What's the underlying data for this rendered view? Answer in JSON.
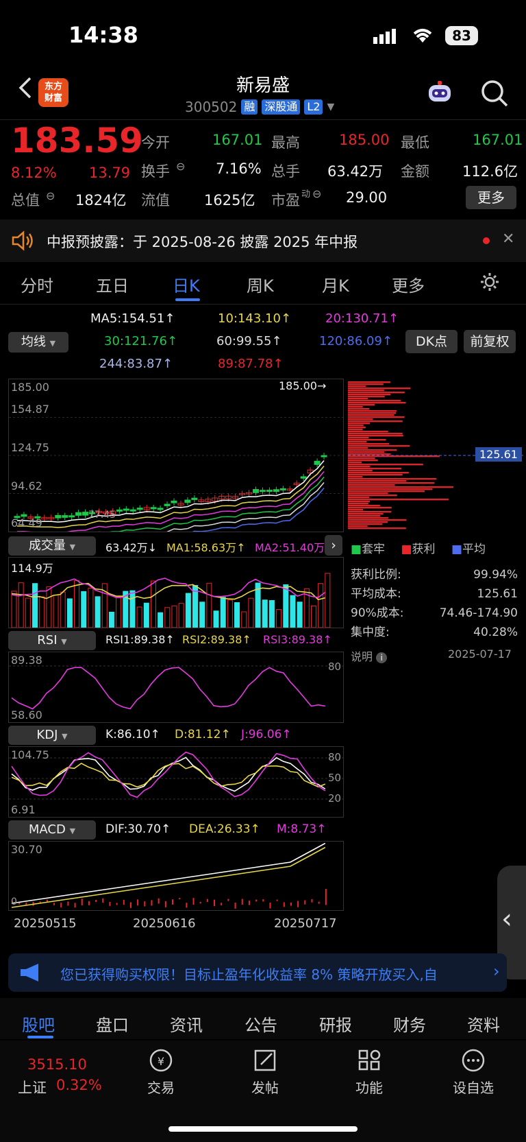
{
  "status": {
    "time": "14:38",
    "battery": "83"
  },
  "header": {
    "back_icon": "chevron-left-icon",
    "logo_text_1": "东方",
    "logo_text_2": "财富",
    "stock_name": "新易盛",
    "stock_code": "300502",
    "tags": [
      "融",
      "深股通",
      "L2"
    ]
  },
  "quote": {
    "price": "183.59",
    "change_pct": "8.12%",
    "change_amt": "13.79",
    "total_value_label": "总值",
    "total_value": "1824亿",
    "open_label": "今开",
    "open": "167.01",
    "turnover_label": "换手",
    "turnover": "7.16%",
    "float_value_label": "流值",
    "float_value": "1625亿",
    "high_label": "最高",
    "high": "185.00",
    "volume_label": "总手",
    "volume": "63.42万",
    "pe_label": "市盈",
    "pe_sup": "动",
    "pe": "29.00",
    "low_label": "最低",
    "low": "167.01",
    "amount_label": "金额",
    "amount": "112.6亿",
    "more_button": "更多"
  },
  "notice": {
    "text": "中报预披露：于 2025-08-26 披露 2025 年中报"
  },
  "chart_tabs": [
    "分时",
    "五日",
    "日K",
    "周K",
    "月K",
    "更多"
  ],
  "active_tab": "日K",
  "ma_panel": {
    "selector": "均线",
    "ma5": "MA5:154.51↑",
    "ma10": "10:143.10↑",
    "ma20": "20:130.71↑",
    "ma30": "30:121.76↑",
    "ma60": "60:99.55↑",
    "ma120": "120:86.09↑",
    "ma244": "244:83.87↑",
    "ma89": "89:87.78↑",
    "dk_button": "DK点",
    "fq_button": "前复权"
  },
  "price_axis": {
    "top": "185.00",
    "l2": "154.87",
    "l3": "124.75",
    "l4": "94.62",
    "bottom": "64.49",
    "high_marker": "185.00",
    "cost_line": "125.61"
  },
  "overlay_labels": [
    "77.45"
  ],
  "volume": {
    "selector": "成交量",
    "vol": "63.42万↓",
    "ma1": "MA1:58.63万↑",
    "ma2": "MA2:51.40万",
    "max": "114.9万"
  },
  "rsi": {
    "selector": "RSI",
    "rsi1": "RSI1:89.38↑",
    "rsi2": "RSI2:89.38↑",
    "rsi3": "RSI3:89.38↑",
    "top": "89.38",
    "bottom": "58.60",
    "level": "80"
  },
  "kdj": {
    "selector": "KDJ",
    "k": "K:86.10↑",
    "d": "D:81.12↑",
    "j": "J:96.06↑",
    "top": "104.75",
    "bottom": "6.91",
    "l80": "80",
    "l50": "50",
    "l20": "20"
  },
  "macd": {
    "selector": "MACD",
    "dif": "DIF:30.70↑",
    "dea": "DEA:26.33↑",
    "m": "M:8.73↑",
    "top": "30.70",
    "bottom": "0"
  },
  "dates": [
    "20250515",
    "20250616",
    "20250717"
  ],
  "chips": {
    "legend": [
      "套牢",
      "获利",
      "平均"
    ],
    "profit_ratio_label": "获利比例:",
    "profit_ratio": "99.94%",
    "avg_cost_label": "平均成本:",
    "avg_cost": "125.61",
    "cost90_label": "90%成本:",
    "cost90": "74.46-174.90",
    "concentration_label": "集中度:",
    "concentration": "40.28%",
    "explain_label": "说明",
    "date": "2025-07-17"
  },
  "banner": {
    "text": "您已获得购买权限！目标止盈年化收益率 8% 策略开放买入,自"
  },
  "bottom_tabs": [
    "股吧",
    "盘口",
    "资讯",
    "公告",
    "研报",
    "财务",
    "资料"
  ],
  "toolbar": {
    "index_value": "3515.10",
    "index_name": "上证",
    "index_pct": "0.32%",
    "items": [
      "交易",
      "发帖",
      "功能",
      "设自选"
    ]
  },
  "colors": {
    "up": "#e8262a",
    "down": "#1fc84a",
    "accent": "#2a6cd8"
  }
}
